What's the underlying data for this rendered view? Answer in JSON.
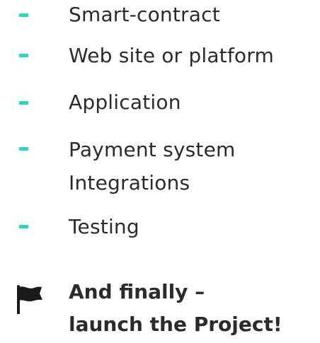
{
  "colors": {
    "accent": "#2BD4C3",
    "text": "#2B2B2B"
  },
  "steps": [
    {
      "label": "Smart-contract"
    },
    {
      "label": "Web site or platform"
    },
    {
      "label": "Application"
    },
    {
      "label": "Payment system",
      "label2": "Integrations"
    },
    {
      "label": "Testing"
    }
  ],
  "final": {
    "icon": "flag-icon",
    "line1": "And finally –",
    "line2": "launch the Project!"
  }
}
